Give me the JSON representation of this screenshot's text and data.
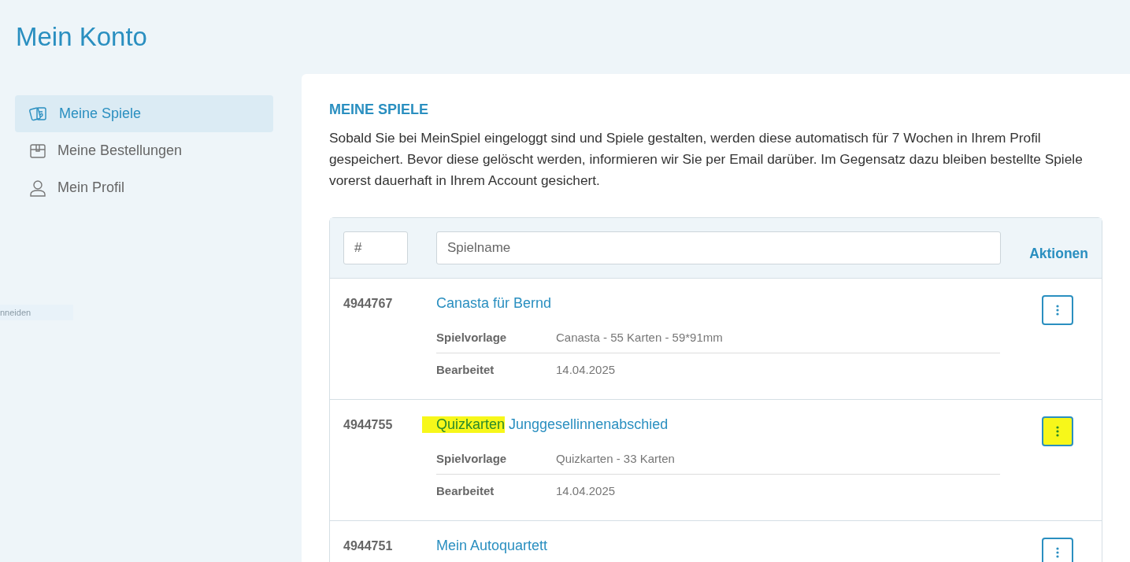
{
  "page_title": "Mein Konto",
  "ghost_text": "nneiden",
  "sidebar": {
    "items": [
      {
        "label": "Meine Spiele",
        "kind": "cards",
        "selected": true
      },
      {
        "label": "Meine Bestellungen",
        "kind": "box",
        "selected": false
      },
      {
        "label": "Mein Profil",
        "kind": "person",
        "selected": false
      }
    ]
  },
  "section": {
    "heading": "MEINE SPIELE",
    "intro": "Sobald Sie bei MeinSpiel eingeloggt sind und Spiele gestalten, werden diese automatisch für 7 Wochen in Ihrem Profil gespeichert. Bevor diese gelöscht werden, informieren wir Sie per Email darüber. Im Gegensatz dazu bleiben bestellte Spiele vorerst dauerhaft in Ihrem Account gesichert."
  },
  "table": {
    "filters": {
      "id_placeholder": "#",
      "name_placeholder": "Spielname"
    },
    "actions_heading": "Aktionen",
    "rows": [
      {
        "id": "4944767",
        "title": [
          {
            "text": "Canasta für Bernd",
            "highlighted": false
          }
        ],
        "details": [
          {
            "label": "Spielvorlage",
            "value": "Canasta - 55 Karten - 59*91mm"
          },
          {
            "label": "Bearbeitet",
            "value": "14.04.2025"
          }
        ],
        "menu_highlighted": false
      },
      {
        "id": "4944755",
        "title": [
          {
            "text": "Quizkarten",
            "highlighted": true
          },
          {
            "text": "Junggesellinnenabschied",
            "highlighted": false
          }
        ],
        "details": [
          {
            "label": "Spielvorlage",
            "value": "Quizkarten - 33 Karten"
          },
          {
            "label": "Bearbeitet",
            "value": "14.04.2025"
          }
        ],
        "menu_highlighted": true
      },
      {
        "id": "4944751",
        "title": [
          {
            "text": "Mein Autoquartett",
            "highlighted": false
          }
        ],
        "menu_highlighted": false
      }
    ]
  }
}
